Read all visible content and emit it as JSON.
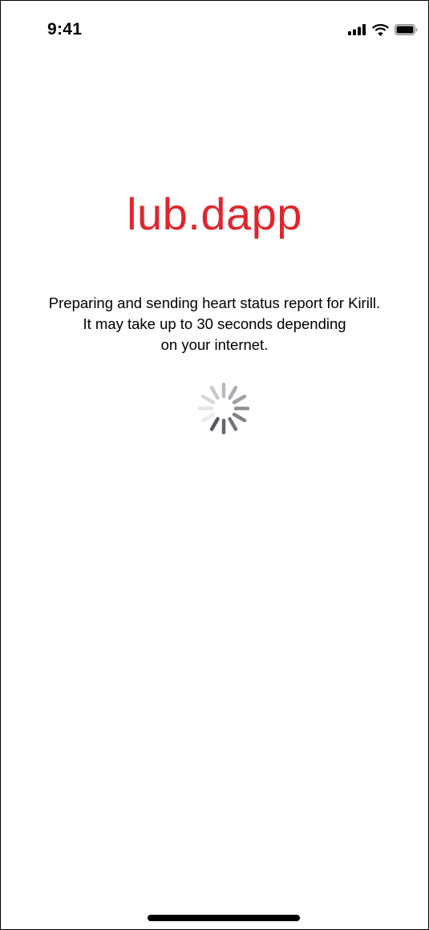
{
  "status_bar": {
    "time": "9:41",
    "icons": [
      "cellular-signal-icon",
      "wifi-icon",
      "battery-icon"
    ]
  },
  "brand": {
    "name": "lub.dapp",
    "color": "#e0262c"
  },
  "message": {
    "lines": [
      "Preparing and sending heart status report for Kirill.",
      "It may take up to 30 seconds depending",
      "on your internet."
    ]
  },
  "loading": {
    "icon": "activity-spinner-icon",
    "active": true
  }
}
